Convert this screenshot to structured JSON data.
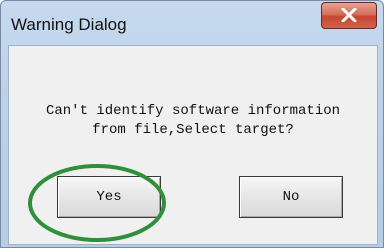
{
  "window": {
    "title": "Warning Dialog"
  },
  "message": {
    "line1": "Can't identify software information",
    "line2": "from file,Select target?"
  },
  "buttons": {
    "yes_label": "Yes",
    "no_label": "No"
  },
  "icons": {
    "close": "close-icon"
  },
  "colors": {
    "annotation_circle": "#2f8f3a",
    "close_button": "#c74531",
    "title_bar": "#bcd2ea"
  }
}
